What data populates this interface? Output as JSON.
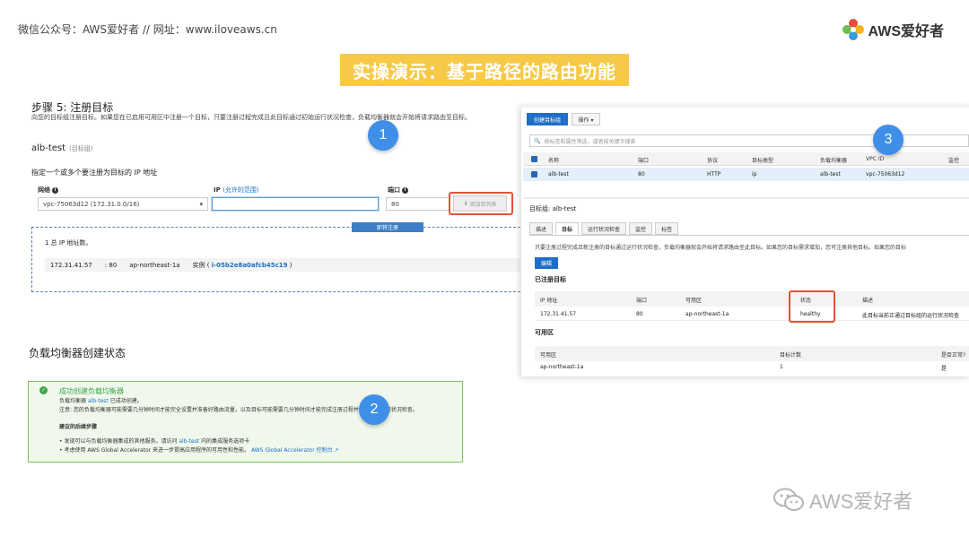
{
  "header": {
    "left_text": "微信公众号：AWS爱好者 // 网址：www.iloveaws.cn",
    "logo_text": "AWS爱好者",
    "banner": "实操演示：基于路径的路由功能"
  },
  "step": {
    "title": "步骤 5: 注册目标",
    "description": "向您的目标组注册目标。如果您在已启用可用区中注册一个目标，只要注册过程完成且此目标通过初始运行状况检查，负载均衡器就会开始将请求路由至目标。",
    "target_group_name": "alb-test",
    "target_group_sub": "(目标组)",
    "specify_label": "指定一个或多个要注册为目标的 IP 地址",
    "network_label": "网络",
    "ip_label": "IP",
    "ip_hint": "(允许的范围)",
    "port_label": "端口",
    "network_value": "vpc-75063d12 (172.31.0.0/16)",
    "ip_value": "",
    "port_value": "80",
    "add_button": "添加到列表",
    "pending_button": "即将注册",
    "total_text": "1 总 IP 地址数。",
    "pending_row": {
      "ip": "172.31.41.57",
      "port": "80",
      "az": "ap-northeast-1a",
      "instance_label": "实例 (",
      "instance_id": "i-05b2e8a0afcb45c19",
      "instance_close": ")"
    }
  },
  "lb_status": {
    "title": "负载均衡器创建状态",
    "success_title": "成功创建负载均衡器",
    "line1_pre": "负载均衡器",
    "line1_link": "alb-test",
    "line1_post": "已成功创建。",
    "line2": "注意: 您的负载均衡器可能需要几分钟时间才能完全设置并准备好路由流量，以及目标可能需要几分钟时间才能完成注册过程并通过初始运行状况检查。",
    "next_steps": "建议的后续步骤",
    "bullet1_pre": "• 发现可以与负载均衡器集成的其他服务。请访问",
    "bullet1_link": "alb-test",
    "bullet1_post": "内的集成服务选项卡",
    "bullet2_pre": "• 考虑使用 AWS Global Accelerator 来进一步提高应用程序的可用性和性能。",
    "bullet2_link": "AWS Global Accelerator 控制台"
  },
  "callouts": [
    "1",
    "2",
    "3"
  ],
  "target_groups": {
    "create_button": "创建目标组",
    "actions_button": "操作 ▾",
    "search_placeholder": "按标签和属性筛选，或者按关键字搜索",
    "columns": [
      "名称",
      "端口",
      "协议",
      "目标类型",
      "负载均衡器",
      "VPC ID",
      "监控"
    ],
    "row": [
      "alb-test",
      "80",
      "HTTP",
      "ip",
      "alb-test",
      "vpc-75063d12",
      ""
    ]
  },
  "detail": {
    "tg_label": "目标组: alb-test",
    "tabs": [
      "描述",
      "目标",
      "运行状况检查",
      "监控",
      "标签"
    ],
    "active_tab": "目标",
    "description": "只要注册过程完成且新注册的目标通过运行状况检查，负载均衡器就会开始将请求路由至此目标。如果您的目标需求增加，您可注册其他目标。如果您的目标",
    "edit_button": "编辑",
    "registered_title": "已注册目标",
    "reg_columns": [
      "IP 地址",
      "端口",
      "可用区",
      "状态",
      "描述"
    ],
    "reg_row": [
      "172.31.41.57",
      "80",
      "ap-northeast-1a",
      "healthy",
      "此目标当前正通过目标组的运行状况检查"
    ],
    "az_title": "可用区",
    "az_columns": [
      "可用区",
      "目标计数",
      "是否正常?"
    ],
    "az_row": [
      "ap-northeast-1a",
      "1",
      "是"
    ]
  },
  "watermark": "AWS爱好者",
  "colors": {
    "banner_bg": "#f7c948",
    "aws_blue": "#1f6fc9",
    "highlight_red": "#e0533b",
    "success_green": "#3fa34d"
  }
}
